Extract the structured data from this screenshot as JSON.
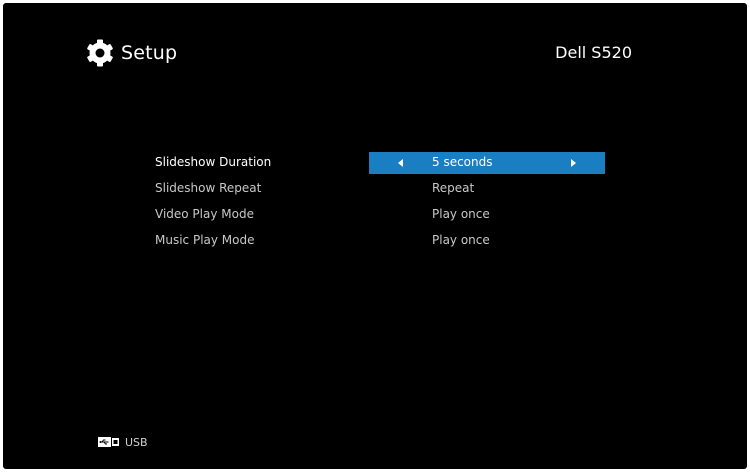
{
  "header": {
    "title": "Setup",
    "title_icon": "gear-icon",
    "model": "Dell S520"
  },
  "menu": {
    "items": [
      {
        "label": "Slideshow Duration",
        "value": "5 seconds",
        "selected": true
      },
      {
        "label": "Slideshow Repeat",
        "value": "Repeat",
        "selected": false
      },
      {
        "label": "Video Play Mode",
        "value": "Play once",
        "selected": false
      },
      {
        "label": "Music Play Mode",
        "value": "Play once",
        "selected": false
      }
    ]
  },
  "footer": {
    "source_icon": "usb-icon",
    "source_label": "USB"
  },
  "colors": {
    "background": "#000000",
    "highlight": "#1a7ec3",
    "text": "#ffffff",
    "text_dim": "#c8c8c8"
  }
}
